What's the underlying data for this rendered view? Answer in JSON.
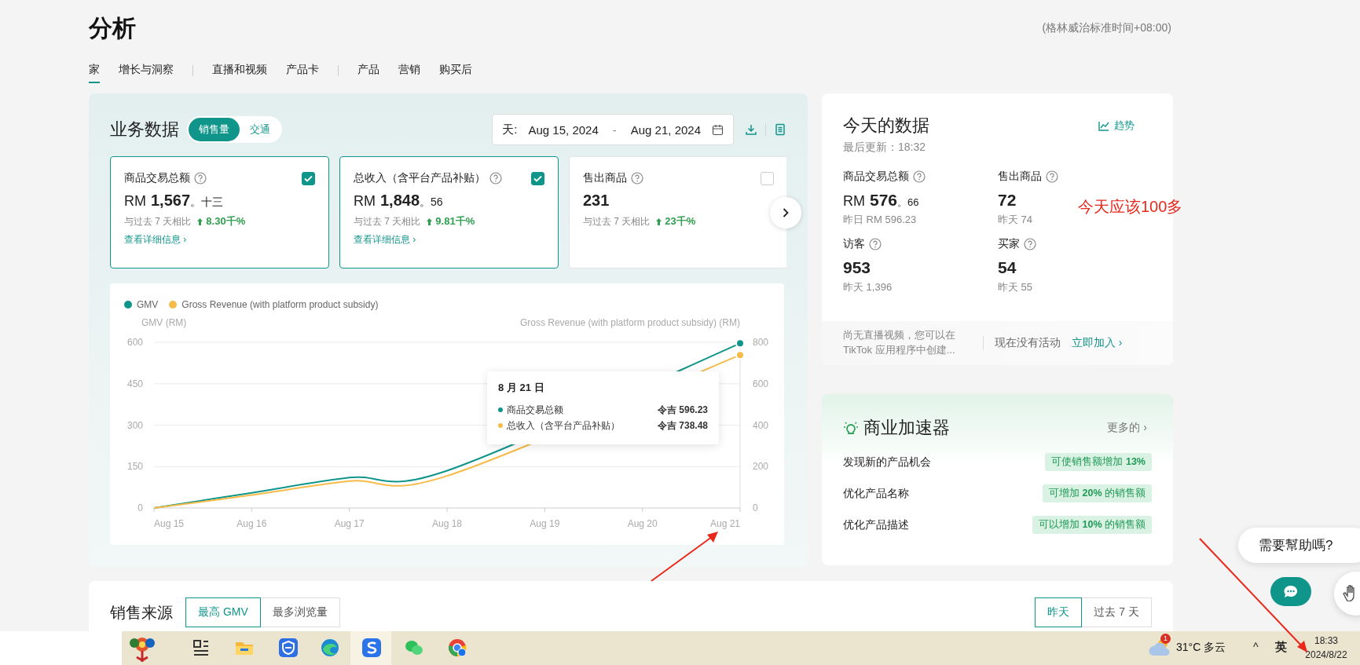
{
  "page": {
    "title": "分析",
    "timezone": "(格林威治标准时间+08:00)"
  },
  "nav": [
    {
      "kind": "tab",
      "label": "家",
      "selected": true
    },
    {
      "kind": "tab",
      "label": "增长与洞察",
      "selected": false
    },
    {
      "kind": "divider"
    },
    {
      "kind": "tab",
      "label": "直播和视频",
      "selected": false
    },
    {
      "kind": "tab",
      "label": "产品卡",
      "selected": false
    },
    {
      "kind": "divider"
    },
    {
      "kind": "tab",
      "label": "产品",
      "selected": false
    },
    {
      "kind": "tab",
      "label": "营销",
      "selected": false
    },
    {
      "kind": "tab",
      "label": "购买后",
      "selected": false
    }
  ],
  "business": {
    "title": "业务数据",
    "modes": [
      {
        "label": "销售量",
        "selected": true
      },
      {
        "label": "交通",
        "selected": false
      }
    ],
    "date_range": {
      "label": "天:",
      "start": "Aug 15, 2024",
      "separator": "-",
      "end": "Aug 21, 2024"
    },
    "metrics": [
      {
        "title": "商品交易总额",
        "checked": true,
        "currency": "RM",
        "value": "1,567",
        "decimals": "。十三",
        "compare": "与过去 7 天相比",
        "change": "8.30千%",
        "link": "查看详细信息 ›"
      },
      {
        "title": "总收入（含平台产品补贴）",
        "checked": true,
        "currency": "RM",
        "value": "1,848",
        "decimals": "。56",
        "compare": "与过去 7 天相比",
        "change": "9.81千%",
        "link": "查看详细信息 ›"
      },
      {
        "title": "售出商品",
        "checked": false,
        "value": "231",
        "compare": "与过去 7 天相比",
        "change": "23千%"
      }
    ],
    "chart_data": {
      "type": "line",
      "categories": [
        "Aug 15",
        "Aug 16",
        "Aug 17",
        "Aug 18",
        "Aug 19",
        "Aug 20",
        "Aug 21"
      ],
      "ylabel": "GMV (RM)",
      "ylim": [
        0,
        600
      ],
      "yticks": [
        0,
        150,
        300,
        450,
        600
      ],
      "y2label": "Gross Revenue (with platform product subsidy) (RM)",
      "y2lim": [
        0,
        800
      ],
      "y2ticks": [
        0,
        200,
        400,
        600,
        800
      ],
      "series": [
        {
          "name": "GMV",
          "color": "#10958b",
          "values": [
            0,
            55,
            110,
            135,
            null,
            null,
            596.23
          ]
        },
        {
          "name": "Gross Revenue (with platform product subsidy)",
          "color": "#f6bb48",
          "axis": "y2",
          "values": [
            0,
            62,
            130,
            155,
            null,
            null,
            738.48
          ]
        }
      ],
      "grid": true,
      "legend": "top"
    },
    "tooltip": {
      "title": "8 月 21 日",
      "rows": [
        {
          "label": "商品交易总额",
          "value": "令吉 596.23",
          "color": "#10958b"
        },
        {
          "label": "总收入（含平台产品补贴）",
          "value": "令吉 738.48",
          "color": "#f6bb48"
        }
      ]
    }
  },
  "today": {
    "title": "今天的数据",
    "trend_link": "趋势",
    "updated": "最后更新：18:32",
    "metrics": [
      {
        "label": "商品交易总额",
        "currency": "RM",
        "value": "576",
        "decimals": "。66",
        "previous": "昨日 RM 596.23"
      },
      {
        "label": "售出商品",
        "value": "72",
        "previous": "昨天 74"
      },
      {
        "label": "访客",
        "value": "953",
        "previous": "昨天 1,396"
      },
      {
        "label": "买家",
        "value": "54",
        "previous": "昨天 55"
      }
    ],
    "live_notice": "尚无直播视频，您可以在 TikTok 应用程序中创建...",
    "activity": "现在没有活动",
    "join_link": "立即加入 ›"
  },
  "accelerator": {
    "title": "商业加速器",
    "more": "更多的 ›",
    "items": [
      {
        "label": "发现新的产品机会",
        "badge": "可使销售额增加 **13%**"
      },
      {
        "label": "优化产品名称",
        "badge": "可增加 **20%** 的销售额"
      },
      {
        "label": "优化产品描述",
        "badge": "可以增加 **10%** 的销售额"
      }
    ]
  },
  "sources": {
    "title": "销售来源",
    "tabs": [
      {
        "label": "最高 GMV",
        "selected": true
      },
      {
        "label": "最多浏览量",
        "selected": false
      }
    ],
    "periods": [
      {
        "label": "昨天",
        "selected": true
      },
      {
        "label": "过去 7 天",
        "selected": false
      }
    ]
  },
  "help": {
    "prompt": "需要幫助嗎?"
  },
  "annotation": {
    "note": "今天应该100多"
  },
  "taskbar": {
    "weather_badge": "1",
    "temperature": "31°C",
    "condition": "多云",
    "tray_caret": "^",
    "ime": "英",
    "time": "18:33",
    "date": "2024/8/22"
  }
}
